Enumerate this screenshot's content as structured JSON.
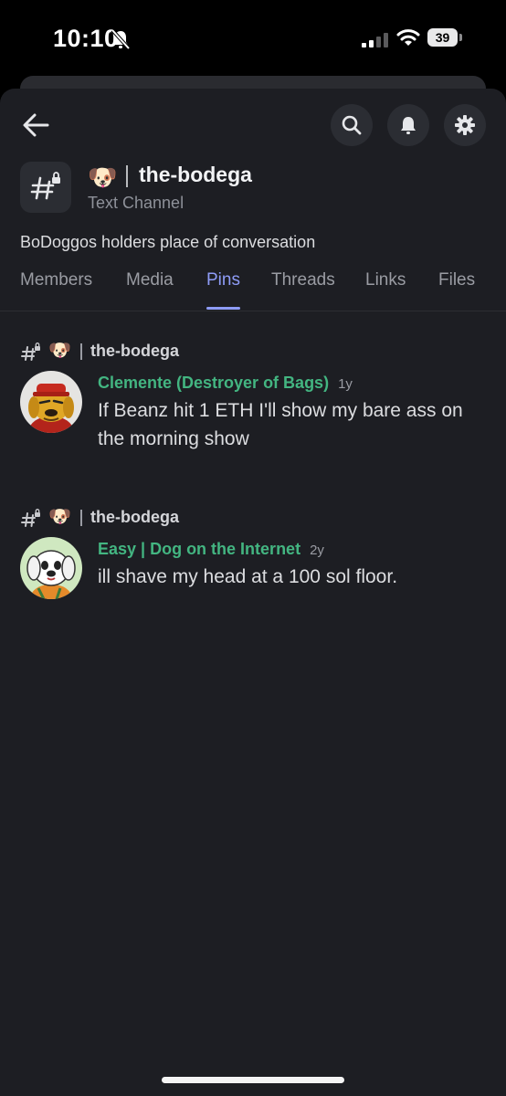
{
  "status_bar": {
    "time": "10:10",
    "battery": "39"
  },
  "header": {
    "channel_emoji": "🐶",
    "channel_name": "the-bodega",
    "channel_type": "Text Channel",
    "description": "BoDoggos holders place of conversation"
  },
  "tabs": [
    {
      "label": "Members",
      "active": false
    },
    {
      "label": "Media",
      "active": false
    },
    {
      "label": "Pins",
      "active": true
    },
    {
      "label": "Threads",
      "active": false
    },
    {
      "label": "Links",
      "active": false
    },
    {
      "label": "Files",
      "active": false
    }
  ],
  "pins": [
    {
      "channel_emoji": "🐶",
      "channel_name": "the-bodega",
      "author": "Clemente (Destroyer of Bags)",
      "time": "1y",
      "message": "If Beanz hit 1 ETH I'll show my bare ass on the morning show"
    },
    {
      "channel_emoji": "🐶",
      "channel_name": "the-bodega",
      "author": "Easy | Dog on the Internet",
      "time": "2y",
      "message": "ill shave my head at a 100 sol floor."
    }
  ],
  "colors": {
    "background": "#1d1e23",
    "accent": "#8e9cf7",
    "author": "#43b581"
  }
}
